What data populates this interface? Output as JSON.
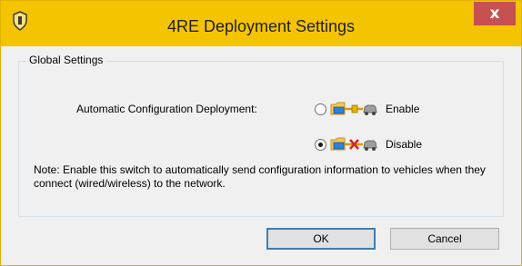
{
  "window": {
    "title": "4RE Deployment Settings",
    "close_label": "x"
  },
  "group": {
    "legend": "Global Settings",
    "field_label": "Automatic Configuration Deployment:",
    "options": [
      {
        "label": "Enable",
        "selected": false,
        "icon": "deployment-connected-icon"
      },
      {
        "label": "Disable",
        "selected": true,
        "icon": "deployment-disconnected-icon"
      }
    ],
    "note": "Note: Enable this switch to automatically send configuration information to vehicles when they connect (wired/wireless) to the network."
  },
  "buttons": {
    "ok_label": "OK",
    "cancel_label": "Cancel"
  },
  "colors": {
    "titlebar": "#f5c400",
    "close_button": "#c75050",
    "dialog_bg": "#f0f0f0"
  }
}
